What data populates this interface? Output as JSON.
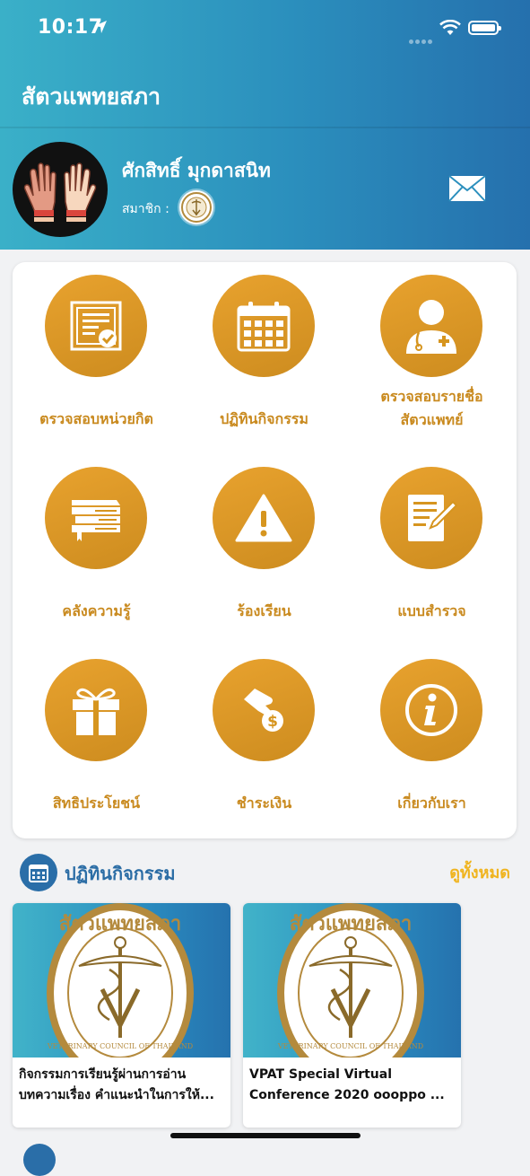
{
  "status": {
    "time": "10:17"
  },
  "app": {
    "title": "สัตวแพทยสภา"
  },
  "profile": {
    "name": "ศักสิทธิ์ มุกดาสนิท",
    "member_label": "สมาชิก :"
  },
  "menu": [
    {
      "id": "check-credits",
      "label_lines": [
        "ตรวจสอบหน่วยกิต"
      ],
      "icon": "certificate-check-icon"
    },
    {
      "id": "calendar",
      "label_lines": [
        "ปฏิทินกิจกรรม"
      ],
      "icon": "calendar-icon"
    },
    {
      "id": "vet-search",
      "label_lines": [
        "ตรวจสอบรายชื่อ",
        "สัตวแพทย์"
      ],
      "icon": "doctor-icon"
    },
    {
      "id": "knowledge",
      "label_lines": [
        "คลังความรู้"
      ],
      "icon": "books-icon"
    },
    {
      "id": "complaint",
      "label_lines": [
        "ร้องเรียน"
      ],
      "icon": "warning-icon"
    },
    {
      "id": "survey",
      "label_lines": [
        "แบบสำรวจ"
      ],
      "icon": "survey-edit-icon"
    },
    {
      "id": "benefits",
      "label_lines": [
        "สิทธิประโยชน์"
      ],
      "icon": "gift-icon"
    },
    {
      "id": "payment",
      "label_lines": [
        "ชำระเงิน"
      ],
      "icon": "payment-icon"
    },
    {
      "id": "about",
      "label_lines": [
        "เกี่ยวกับเรา"
      ],
      "icon": "info-icon"
    }
  ],
  "activities": {
    "title": "ปฏิทินกิจกรรม",
    "see_all": "ดูทั้งหมด",
    "items": [
      {
        "title_lines": [
          "กิจกรรมการเรียนรู้ผ่านการอ่าน",
          "บทความเรื่อง คำแนะนำในการให้..."
        ],
        "logo_text_top": "สัตวแพทยสภา",
        "logo_text_bottom": "VETERINARY COUNCIL OF THAILAND"
      },
      {
        "title_lines": [
          "VPAT Special Virtual",
          "Conference 2020 oooppo ..."
        ],
        "logo_text_top": "สัตวแพทยสภา",
        "logo_text_bottom": "VETERINARY COUNCIL OF THAILAND"
      }
    ]
  },
  "colors": {
    "gold": "#d6951f",
    "blue": "#2a6ea8",
    "see_all": "#f0b41f"
  }
}
